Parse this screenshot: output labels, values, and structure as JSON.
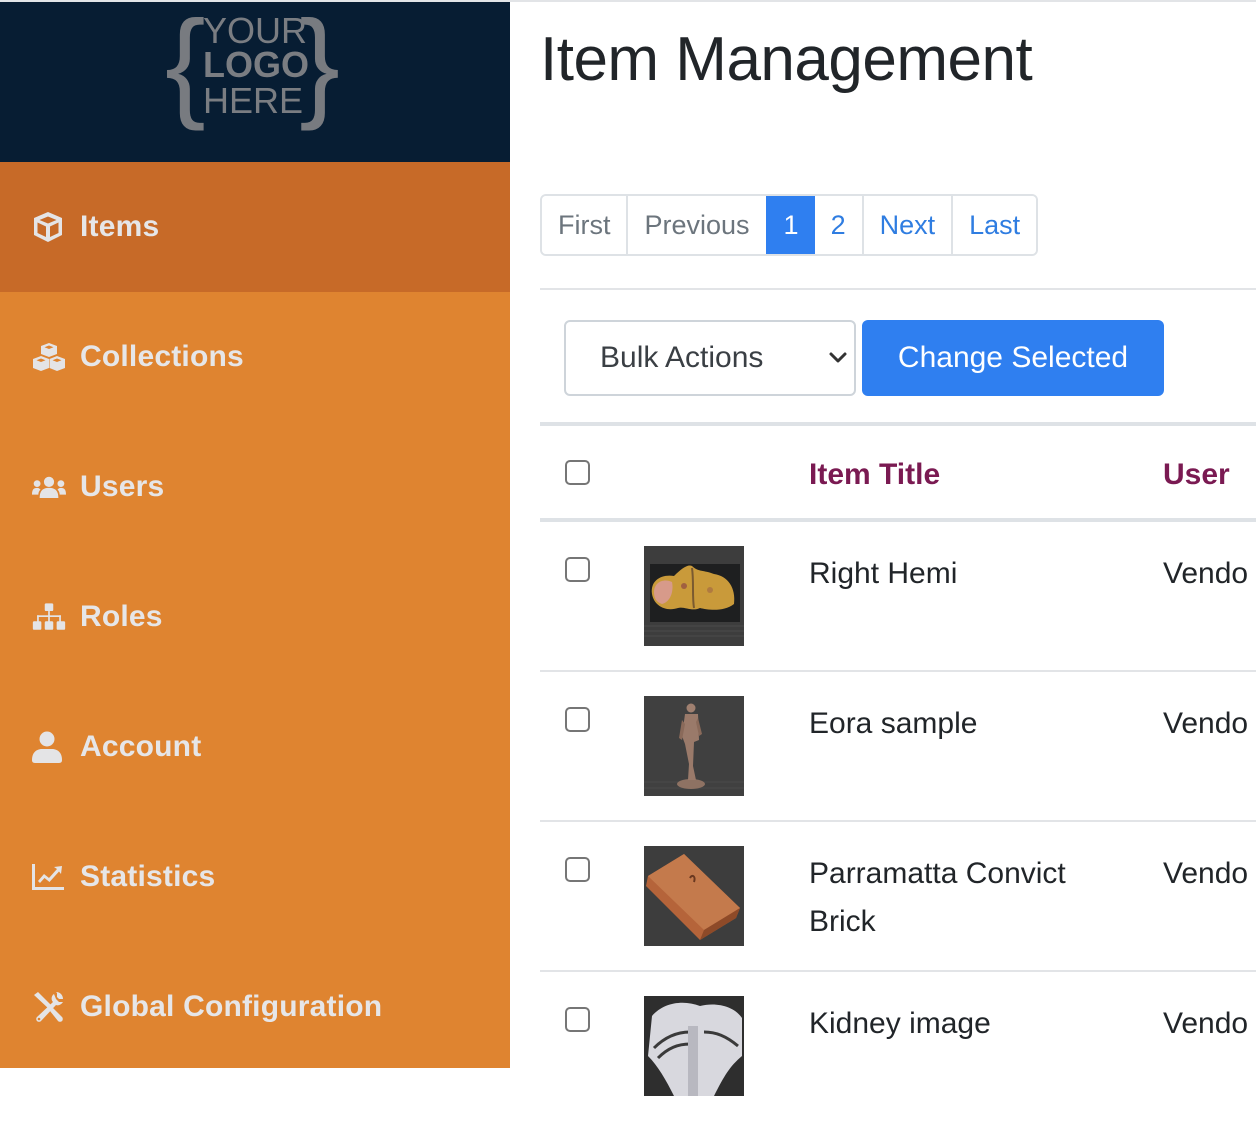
{
  "sidebar": {
    "logo": {
      "line1": "YOUR",
      "line2": "LOGO",
      "line3": "HERE",
      "brace_left": "{",
      "brace_right": "}"
    },
    "items": [
      {
        "label": "Items",
        "icon": "cube-icon",
        "active": true
      },
      {
        "label": "Collections",
        "icon": "cubes-icon",
        "active": false
      },
      {
        "label": "Users",
        "icon": "users-icon",
        "active": false
      },
      {
        "label": "Roles",
        "icon": "sitemap-icon",
        "active": false
      },
      {
        "label": "Account",
        "icon": "user-icon",
        "active": false
      },
      {
        "label": "Statistics",
        "icon": "chart-line-icon",
        "active": false
      },
      {
        "label": "Global Configuration",
        "icon": "tools-icon",
        "active": false
      }
    ]
  },
  "main": {
    "title": "Item Management",
    "pagination": {
      "first": "First",
      "previous": "Previous",
      "pages": [
        "1",
        "2"
      ],
      "current_page": "1",
      "next": "Next",
      "last": "Last"
    },
    "bulk_actions": {
      "selected": "Bulk Actions",
      "button_label": "Change Selected"
    },
    "table": {
      "columns": [
        "",
        "",
        "Item Title",
        "User"
      ],
      "rows": [
        {
          "title": "Right Hemi",
          "user": "Vendo",
          "thumbnail": "brain-specimen-thumbnail"
        },
        {
          "title": "Eora sample",
          "user": "Vendo",
          "thumbnail": "statue-figure-thumbnail"
        },
        {
          "title": "Parramatta Convict Brick",
          "user": "Vendo",
          "thumbnail": "brick-thumbnail"
        },
        {
          "title": "Kidney image",
          "user": "Vendo",
          "thumbnail": "ct-scan-thumbnail"
        }
      ]
    }
  },
  "colors": {
    "sidebar_header_bg": "#071d33",
    "sidebar_bg": "#df8430",
    "sidebar_active_bg": "#c76a28",
    "sidebar_text": "#e6e6e8",
    "primary": "#2f7ff0",
    "column_header": "#7a1a52",
    "link": "#2f7de1"
  }
}
